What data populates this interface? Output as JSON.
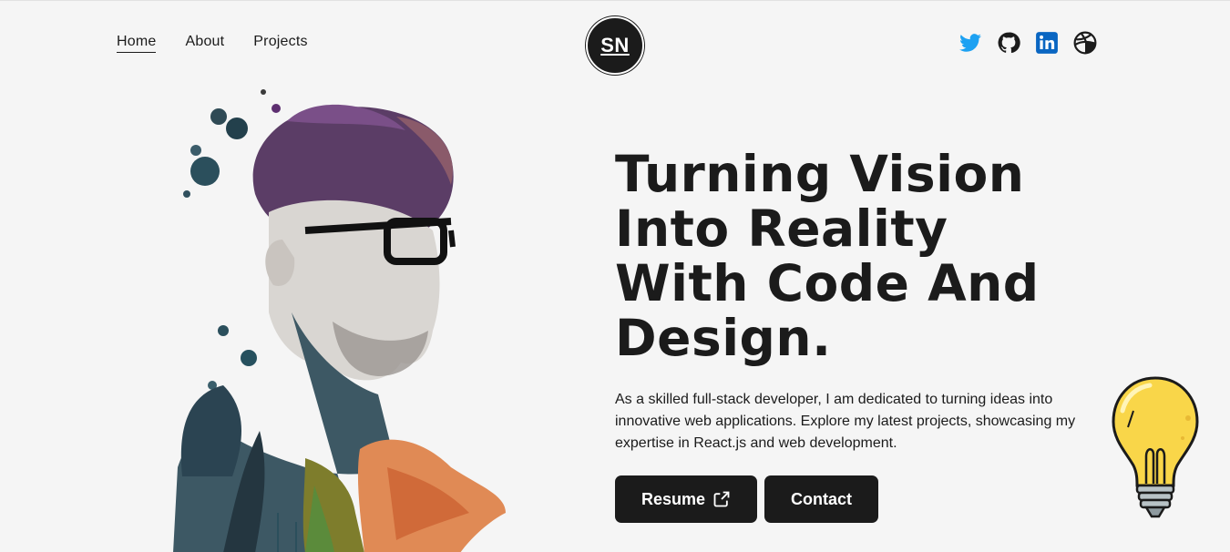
{
  "nav": {
    "items": [
      {
        "label": "Home",
        "active": true
      },
      {
        "label": "About",
        "active": false
      },
      {
        "label": "Projects",
        "active": false
      }
    ]
  },
  "logo": {
    "text": "SN"
  },
  "socials": {
    "icons": [
      "twitter-icon",
      "github-icon",
      "linkedin-icon",
      "dribbble-icon"
    ],
    "colors": {
      "twitter": "#1da1f2",
      "github": "#1b1b1b",
      "linkedin": "#0a66c2",
      "dribbble": "#1b1b1b"
    }
  },
  "hero": {
    "headline": "Turning Vision Into Reality With Code And Design.",
    "intro": "As a skilled full-stack developer, I am dedicated to turning ideas into innovative web applications. Explore my latest projects, showcasing my expertise in React.js and web development.",
    "resume_label": "Resume",
    "contact_label": "Contact"
  },
  "theme": {
    "background": "#f5f5f5",
    "dark": "#1b1b1b",
    "bulb": "#f9d649"
  }
}
